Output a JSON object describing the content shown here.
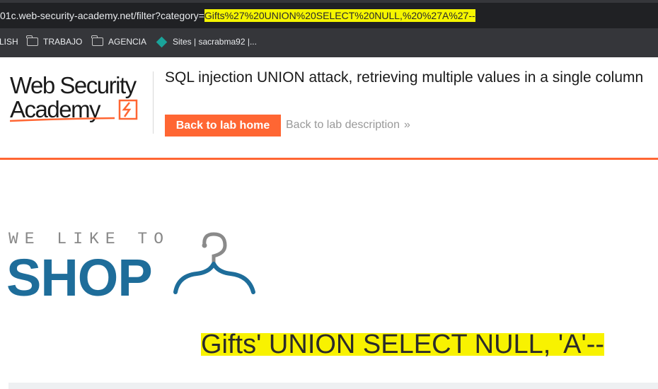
{
  "browser": {
    "url_prefix": "01c.web-security-academy.net/filter?category=",
    "url_highlight": "Gifts%27%20UNION%20SELECT%20NULL,%20%27A%27--",
    "bookmarks": [
      {
        "label": "LISH",
        "icon": "none"
      },
      {
        "label": "TRABAJO",
        "icon": "folder-icon"
      },
      {
        "label": "AGENCIA",
        "icon": "folder-icon"
      },
      {
        "label": "Sites | sacrabma92 |...",
        "icon": "diamond-icon"
      }
    ]
  },
  "header": {
    "logo_line1": "Web Security",
    "logo_line2": "Academy",
    "lab_title": "SQL injection UNION attack, retrieving multiple values in a single column",
    "back_button": "Back to lab home",
    "description_link": "Back to lab description",
    "chevron": "»"
  },
  "shop": {
    "tagline": "WE LIKE TO",
    "word": "SHOP"
  },
  "main": {
    "heading": "Gifts' UNION SELECT NULL, 'A'--"
  },
  "colors": {
    "accent": "#ff6633",
    "shop_blue": "#1e6d9a",
    "highlight": "#f8f200"
  }
}
